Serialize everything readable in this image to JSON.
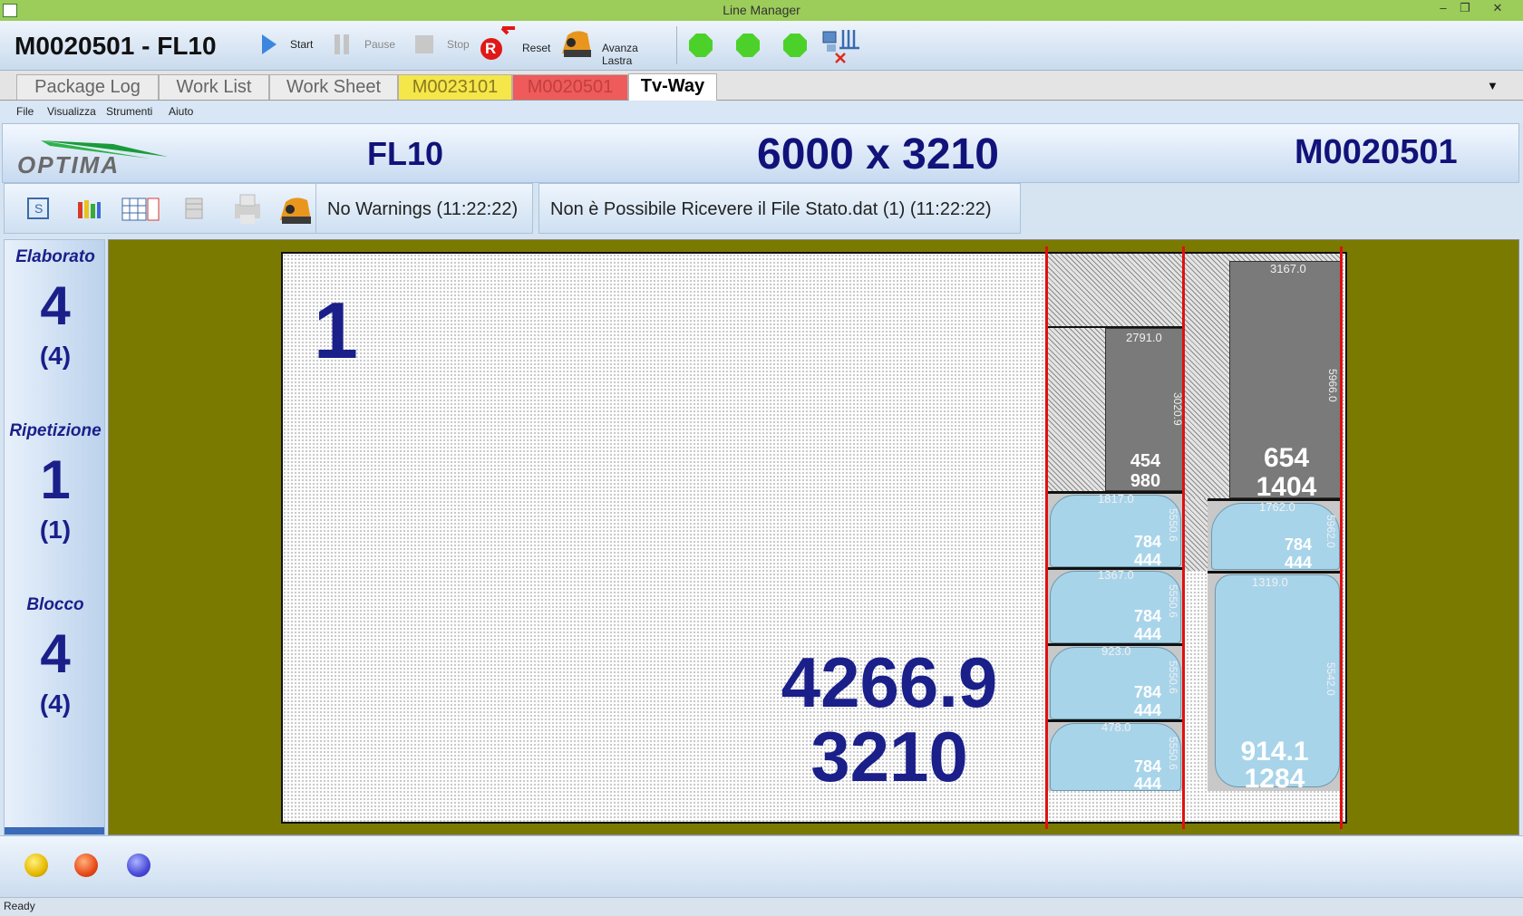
{
  "window": {
    "title": "Line Manager",
    "minimize": "–",
    "restore": "❐",
    "close": "✕"
  },
  "toolbar": {
    "job_title": "M0020501 - FL10",
    "start_label": "Start",
    "pause_label": "Pause",
    "stop_label": "Stop",
    "reset_label": "Reset",
    "advance_label": "Avanza Lastra",
    "reset_icon_letter": "R"
  },
  "tabs": [
    {
      "label": "Package Log"
    },
    {
      "label": "Work List"
    },
    {
      "label": "Work Sheet"
    },
    {
      "label": "M0023101"
    },
    {
      "label": "M0020501"
    },
    {
      "label": "Tv-Way"
    }
  ],
  "tabs_dropdown": "▼",
  "menu": [
    "File",
    "Visualizza",
    "Strumenti",
    "Aiuto"
  ],
  "header": {
    "logo": "OPTIMA",
    "machine": "FL10",
    "size": "6000 x 3210",
    "job": "M0020501"
  },
  "messages": {
    "warnings": "No Warnings (11:22:22)",
    "status": "Non è Possibile Ricevere il File Stato.dat (1) (11:22:22)"
  },
  "side": {
    "elaborato_label": "Elaborato",
    "elaborato_value": "4",
    "elaborato_sub": "(4)",
    "ripetizione_label": "Ripetizione",
    "ripetizione_value": "1",
    "ripetizione_sub": "(1)",
    "blocco_label": "Blocco",
    "blocco_value": "4",
    "blocco_sub": "(4)"
  },
  "sheet": {
    "index": "1",
    "remaining_length": "4266.9",
    "remaining_height": "3210",
    "pieces": [
      {
        "w": "454",
        "h": "980",
        "top_dim": "2791.0",
        "side_dim": "3020.9"
      },
      {
        "w": "654",
        "h": "1404",
        "top_dim": "3167.0",
        "side_dim": "5966.0"
      },
      {
        "w": "784",
        "h": "444",
        "top_dim": "1817.0",
        "side_dim": "5550.6"
      },
      {
        "w": "784",
        "h": "444",
        "top_dim": "1762.0",
        "side_dim": "5962.0"
      },
      {
        "w": "784",
        "h": "444",
        "top_dim": "1367.0",
        "side_dim": "5550.6"
      },
      {
        "w": "784",
        "h": "444",
        "top_dim": "923.0",
        "side_dim": "5550.6"
      },
      {
        "w": "784",
        "h": "444",
        "top_dim": "478.0",
        "side_dim": "5550.6"
      },
      {
        "w": "914.1",
        "h": "1284",
        "top_dim": "1319.0",
        "side_dim": "5542.0"
      }
    ]
  },
  "status_bar": "Ready",
  "colors": {
    "accent": "#1a1f8a",
    "canvas_bg": "#7a7a00",
    "piece_blue": "#a8d4ea",
    "piece_gray": "#7a7a7a",
    "cut_line": "#e01010"
  }
}
